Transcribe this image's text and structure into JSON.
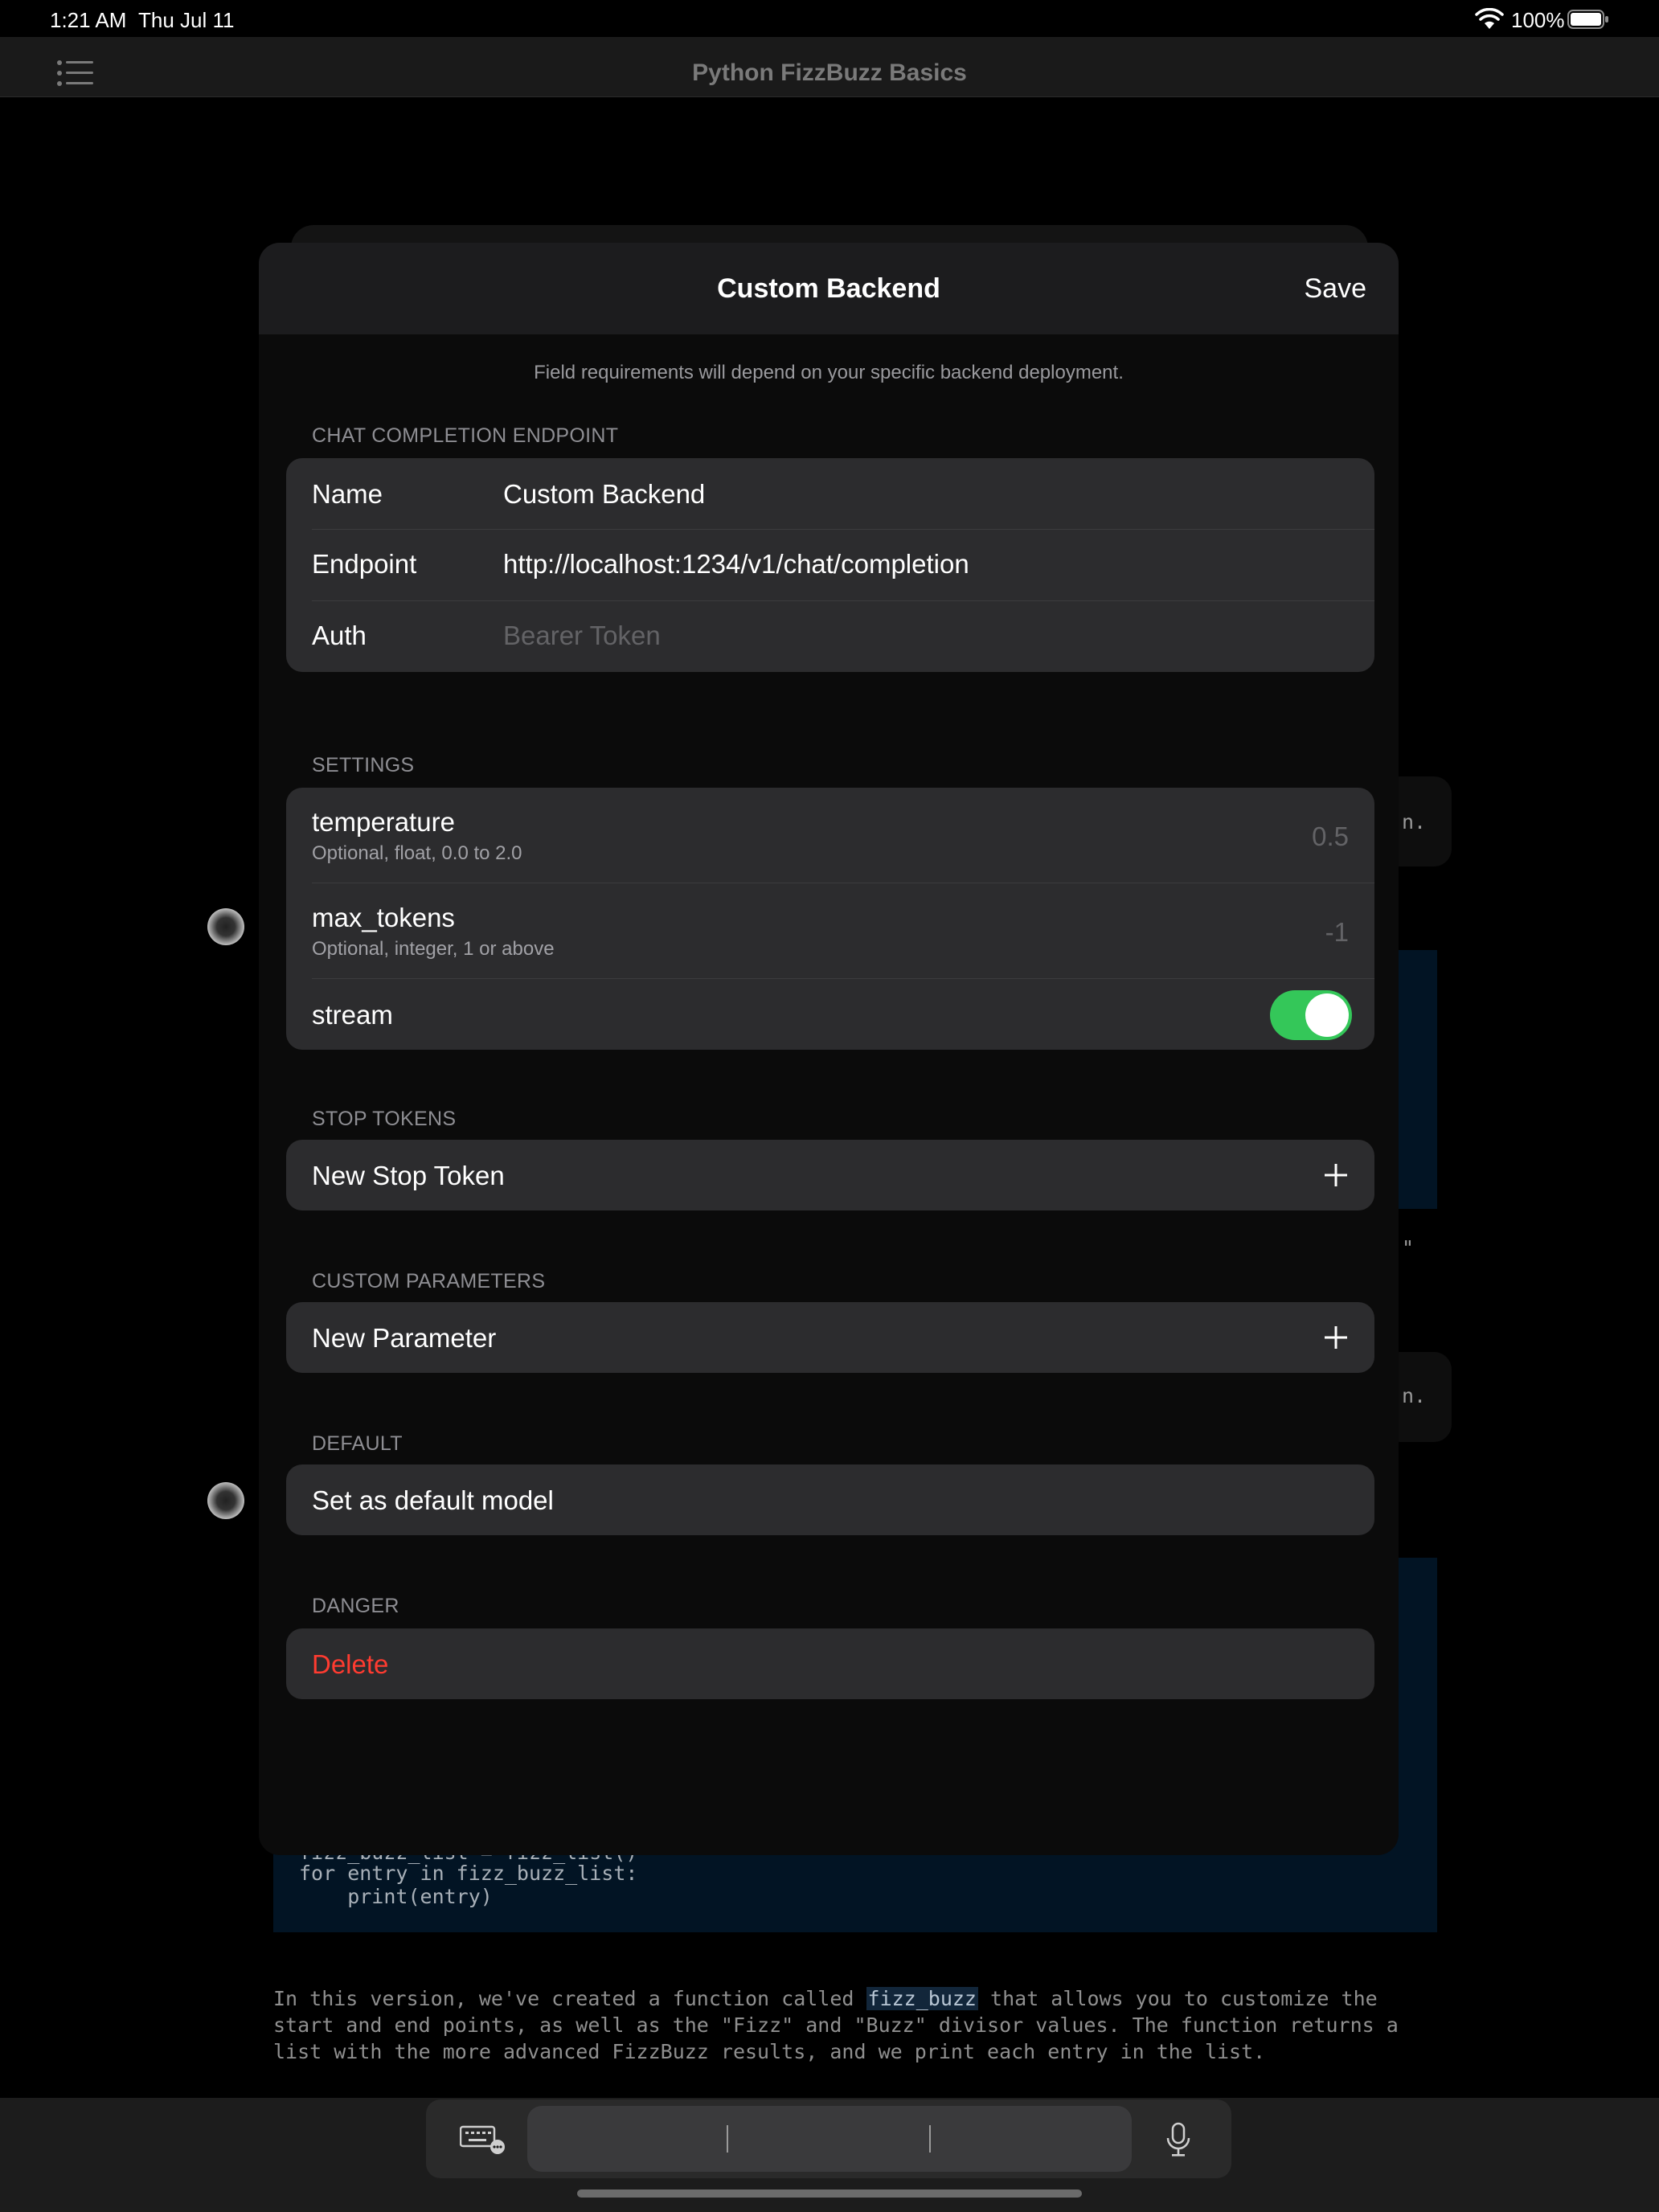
{
  "status_bar": {
    "time": "1:21 AM",
    "date": "Thu Jul 11",
    "battery": "100%"
  },
  "nav": {
    "title": "Python FizzBuzz Basics"
  },
  "background": {
    "snippet_1": "n.",
    "snippet_2": "\"",
    "snippet_3": "n.",
    "code_partial": "fizz_buzz_list = fizz_list()",
    "code_line_1": "for entry in fizz_buzz_list:",
    "code_line_2": "    print(entry)",
    "para_before": "In this version, we've created a function called ",
    "para_code": "fizz_buzz",
    "para_after": " that allows you to customize the start and end points, as well as the \"Fizz\" and \"Buzz\" divisor values. The function returns a list with the more advanced FizzBuzz results, and we print each entry in the list."
  },
  "modal": {
    "title": "Custom Backend",
    "save_label": "Save",
    "hint": "Field requirements will depend on your specific backend deployment.",
    "endpoint_section": {
      "label": "CHAT COMPLETION ENDPOINT",
      "name_label": "Name",
      "name_value": "Custom Backend",
      "endpoint_label": "Endpoint",
      "endpoint_value": "http://localhost:1234/v1/chat/completion",
      "auth_label": "Auth",
      "auth_placeholder": "Bearer Token"
    },
    "settings_section": {
      "label": "SETTINGS",
      "temperature_label": "temperature",
      "temperature_sub": "Optional, float, 0.0 to 2.0",
      "temperature_value": "0.5",
      "max_tokens_label": "max_tokens",
      "max_tokens_sub": "Optional, integer, 1 or above",
      "max_tokens_value": "-1",
      "stream_label": "stream",
      "stream_on": true
    },
    "stop_tokens_section": {
      "label": "STOP TOKENS",
      "add_label": "New Stop Token"
    },
    "custom_params_section": {
      "label": "CUSTOM PARAMETERS",
      "add_label": "New Parameter"
    },
    "default_section": {
      "label": "DEFAULT",
      "button_label": "Set as default model"
    },
    "danger_section": {
      "label": "DANGER",
      "delete_label": "Delete"
    }
  },
  "colors": {
    "toggle_on": "#34c759",
    "danger": "#ff3b30",
    "panel": "#2c2c2e"
  },
  "icons": [
    "wifi-icon",
    "battery-icon",
    "list-icon",
    "plus-icon",
    "keyboard-icon",
    "mic-icon"
  ]
}
